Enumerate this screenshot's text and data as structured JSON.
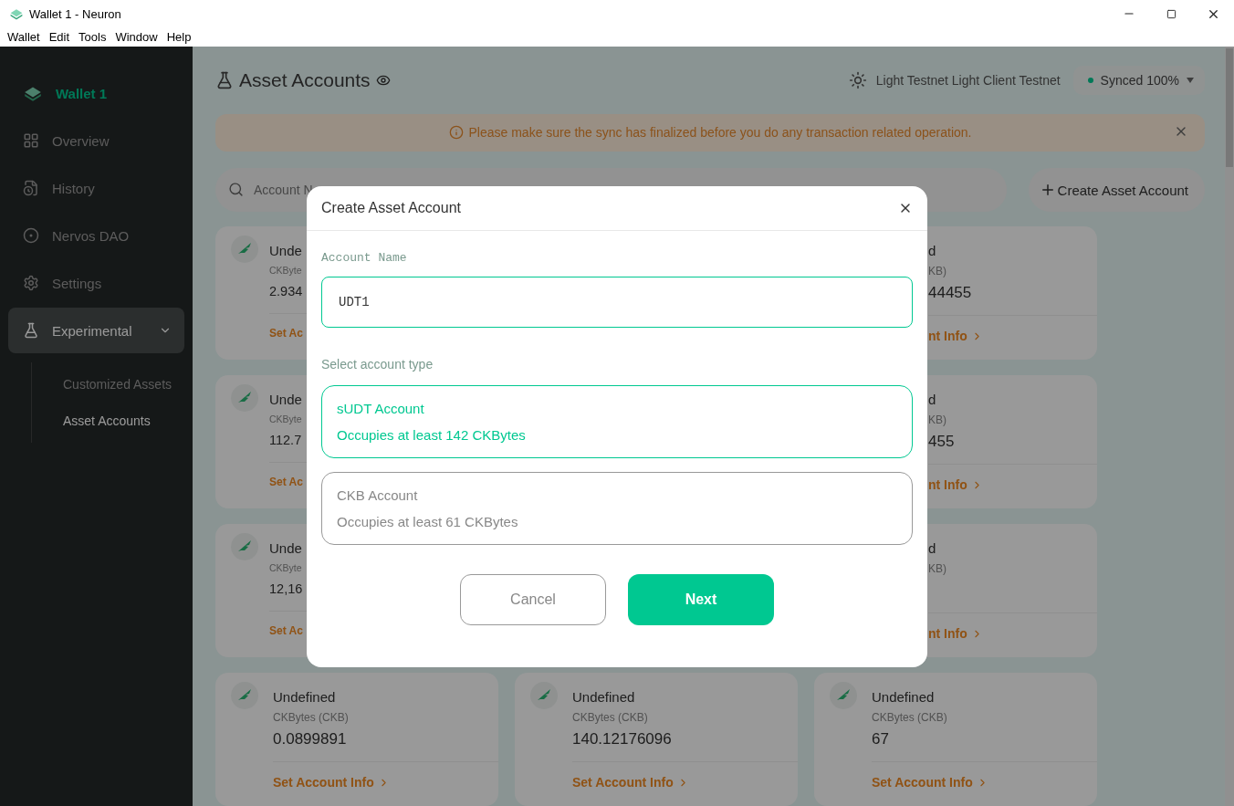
{
  "window": {
    "title": "Wallet 1 - Neuron"
  },
  "menu": [
    "Wallet",
    "Edit",
    "Tools",
    "Window",
    "Help"
  ],
  "sidebar": {
    "wallet_name": "Wallet 1",
    "items": [
      {
        "kind": "overview",
        "label": "Overview",
        "selected": false
      },
      {
        "kind": "history",
        "label": "History",
        "selected": false
      },
      {
        "kind": "dao",
        "label": "Nervos DAO",
        "selected": false
      },
      {
        "kind": "settings",
        "label": "Settings",
        "selected": false
      },
      {
        "kind": "experimental",
        "label": "Experimental",
        "selected": true,
        "expanded": true,
        "children": [
          {
            "label": "Customized Assets",
            "selected": false
          },
          {
            "label": "Asset Accounts",
            "selected": true
          }
        ]
      }
    ]
  },
  "header": {
    "title": "Asset Accounts",
    "network": "Light Testnet Light Client Testnet",
    "sync": "Synced 100%"
  },
  "alert": {
    "text": "Please make sure the sync has finalized before you do any transaction related operation."
  },
  "search": {
    "placeholder": "Account N"
  },
  "create_button": "Create Asset Account",
  "accounts": [
    {
      "kind": "left",
      "name": "Unde",
      "unit": "CKByte",
      "balance": "2.934",
      "link": "Set Ac"
    },
    {
      "kind": "right",
      "name": "d",
      "unit": "KB)",
      "balance": "44455",
      "link": "nt Info"
    },
    {
      "kind": "left",
      "name": "Unde",
      "unit": "CKByte",
      "balance": "112.7",
      "link": "Set Ac"
    },
    {
      "kind": "right",
      "name": "d",
      "unit": "KB)",
      "balance": "455",
      "link": "nt Info"
    },
    {
      "kind": "left",
      "name": "Unde",
      "unit": "CKByte",
      "balance": "12,16",
      "link": "Set Ac"
    },
    {
      "kind": "right",
      "name": "d",
      "unit": "KB)",
      "link": "nt Info"
    },
    {
      "kind": "full",
      "name": "Undefined",
      "unit": "CKBytes (CKB)",
      "balance": "0.0899891",
      "link": "Set Account Info"
    },
    {
      "kind": "full",
      "name": "Undefined",
      "unit": "CKBytes (CKB)",
      "balance": "140.12176096",
      "link": "Set Account Info"
    },
    {
      "kind": "full",
      "name": "Undefined",
      "unit": "CKBytes (CKB)",
      "balance": "67",
      "link": "Set Account Info"
    }
  ],
  "dialog": {
    "title": "Create Asset Account",
    "name_label": "Account Name",
    "name_value": "UDT1",
    "type_label": "Select account type",
    "types": [
      {
        "name": "sUDT Account",
        "note": "Occupies at least 142 CKBytes",
        "selected": true
      },
      {
        "name": "CKB Account",
        "note": "Occupies at least 61 CKBytes",
        "selected": false
      }
    ],
    "cancel": "Cancel",
    "next": "Next"
  }
}
